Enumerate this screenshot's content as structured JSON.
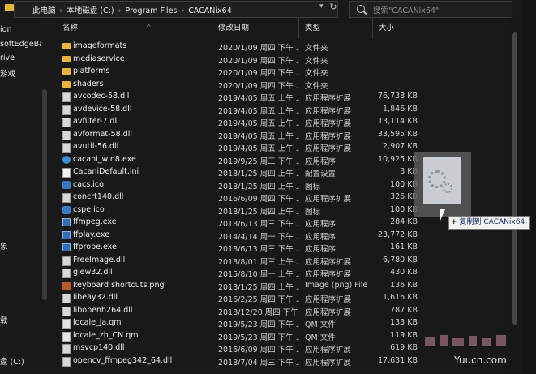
{
  "address": {
    "crumbs": [
      "此电脑",
      "本地磁盘 (C:)",
      "Program Files",
      "CACANix64"
    ],
    "dropdown": "▾",
    "refresh": "↻"
  },
  "search": {
    "placeholder": "搜索\"CACANix64\""
  },
  "nav": {
    "items": [
      "ion",
      "softEdgeBa",
      "rive",
      "游戏",
      "象",
      "载",
      "盘 (C:)"
    ]
  },
  "columns": {
    "name": "名称",
    "date": "修改日期",
    "type": "类型",
    "size": "大小"
  },
  "files": [
    {
      "name": "imageformats",
      "date": "2020/1/09 周四 下午 ...",
      "type": "文件夹",
      "size": "",
      "icon": "folder"
    },
    {
      "name": "mediaservice",
      "date": "2020/1/09 周四 下午 ...",
      "type": "文件夹",
      "size": "",
      "icon": "folder"
    },
    {
      "name": "platforms",
      "date": "2020/1/09 周四 下午 ...",
      "type": "文件夹",
      "size": "",
      "icon": "folder"
    },
    {
      "name": "shaders",
      "date": "2020/1/09 周四 下午 ...",
      "type": "文件夹",
      "size": "",
      "icon": "folder"
    },
    {
      "name": "avcodec-58.dll",
      "date": "2019/4/05 周五 上午 ...",
      "type": "应用程序扩展",
      "size": "76,738 KB",
      "icon": "dll"
    },
    {
      "name": "avdevice-58.dll",
      "date": "2019/4/05 周五 上午 ...",
      "type": "应用程序扩展",
      "size": "1,846 KB",
      "icon": "dll"
    },
    {
      "name": "avfilter-7.dll",
      "date": "2019/4/05 周五 上午 ...",
      "type": "应用程序扩展",
      "size": "13,114 KB",
      "icon": "dll"
    },
    {
      "name": "avformat-58.dll",
      "date": "2019/4/05 周五 上午 ...",
      "type": "应用程序扩展",
      "size": "33,595 KB",
      "icon": "dll"
    },
    {
      "name": "avutil-56.dll",
      "date": "2019/4/05 周五 上午 ...",
      "type": "应用程序扩展",
      "size": "2,907 KB",
      "icon": "dll"
    },
    {
      "name": "cacani_win8.exe",
      "date": "2019/9/25 周三 下午 ...",
      "type": "应用程序",
      "size": "10,925 KB",
      "icon": "win8"
    },
    {
      "name": "CacaniDefault.ini",
      "date": "2018/1/25 周四 上午 ...",
      "type": "配置设置",
      "size": "3 KB",
      "icon": "ini"
    },
    {
      "name": "cacs.ico",
      "date": "2018/1/25 周四 上午 ...",
      "type": "图标",
      "size": "100 KB",
      "icon": "ico"
    },
    {
      "name": "concrt140.dll",
      "date": "2016/6/09 周四 下午 ...",
      "type": "应用程序扩展",
      "size": "326 KB",
      "icon": "dll"
    },
    {
      "name": "cspe.ico",
      "date": "2018/1/25 周四 上午 ...",
      "type": "图标",
      "size": "100 KB",
      "icon": "ico"
    },
    {
      "name": "ffmpeg.exe",
      "date": "2018/6/13 周三 下午 ...",
      "type": "应用程序",
      "size": "284 KB",
      "icon": "exe"
    },
    {
      "name": "ffplay.exe",
      "date": "2014/4/14 周一 下午 ...",
      "type": "应用程序",
      "size": "23,772 KB",
      "icon": "exe"
    },
    {
      "name": "ffprobe.exe",
      "date": "2018/6/13 周三 下午 ...",
      "type": "应用程序",
      "size": "161 KB",
      "icon": "exe"
    },
    {
      "name": "FreeImage.dll",
      "date": "2018/8/01 周三 上午 ...",
      "type": "应用程序扩展",
      "size": "6,780 KB",
      "icon": "dll"
    },
    {
      "name": "glew32.dll",
      "date": "2015/8/10 周一 上午 ...",
      "type": "应用程序扩展",
      "size": "430 KB",
      "icon": "dll"
    },
    {
      "name": "keyboard shortcuts.png",
      "date": "2018/1/25 周四 上午 ...",
      "type": "Image (png) File",
      "size": "136 KB",
      "icon": "png"
    },
    {
      "name": "libeay32.dll",
      "date": "2016/2/25 周四 下午 ...",
      "type": "应用程序扩展",
      "size": "1,616 KB",
      "icon": "dll"
    },
    {
      "name": "libopenh264.dll",
      "date": "2018/12/20 周四 下午 ...",
      "type": "应用程序扩展",
      "size": "787 KB",
      "icon": "dll"
    },
    {
      "name": "locale_ja.qm",
      "date": "2019/5/23 周四 下午 ...",
      "type": "QM 文件",
      "size": "133 KB",
      "icon": "qm"
    },
    {
      "name": "locale_zh_CN.qm",
      "date": "2019/5/23 周四 下午 ...",
      "type": "QM 文件",
      "size": "119 KB",
      "icon": "qm"
    },
    {
      "name": "msvcp140.dll",
      "date": "2016/6/09 周四 下午 ...",
      "type": "应用程序扩展",
      "size": "619 KB",
      "icon": "dll"
    },
    {
      "name": "opencv_ffmpeg342_64.dll",
      "date": "2018/7/04 周三 下午 ...",
      "type": "应用程序扩展",
      "size": "17,631 KB",
      "icon": "dll"
    }
  ],
  "drag": {
    "tooltip_plus": "+",
    "tooltip_text": "复制到 CACANix64"
  },
  "watermark": "Yuucn.com"
}
